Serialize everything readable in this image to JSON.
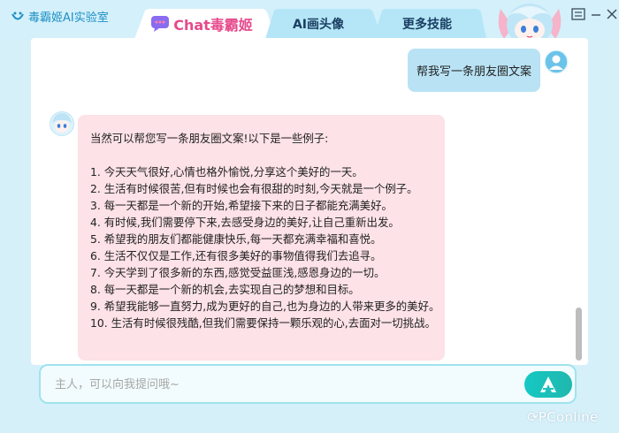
{
  "app": {
    "title": "毒霸姬AI实验室"
  },
  "tabs": [
    {
      "label": "Chat毒霸姬",
      "active": true,
      "icon": "chat-bubble-icon"
    },
    {
      "label": "AI画头像",
      "active": false
    },
    {
      "label": "更多技能",
      "active": false
    }
  ],
  "window_controls": [
    "menu-icon",
    "minimize-icon",
    "close-icon"
  ],
  "chat": {
    "user_message": "帮我写一条朋友圈文案",
    "bot_reply": {
      "intro": "当然可以帮您写一条朋友圈文案!以下是一些例子:",
      "lines": [
        "1. 今天天气很好,心情也格外愉悦,分享这个美好的一天。",
        "2. 生活有时候很苦,但有时候也会有很甜的时刻,今天就是一个例子。",
        "3. 每一天都是一个新的开始,希望接下来的日子都能充满美好。",
        "4. 有时候,我们需要停下来,去感受身边的美好,让自己重新出发。",
        "5. 希望我的朋友们都能健康快乐,每一天都充满幸福和喜悦。",
        "6. 生活不仅仅是工作,还有很多美好的事物值得我们去追寻。",
        "7. 今天学到了很多新的东西,感觉受益匪浅,感恩身边的一切。",
        "8. 每一天都是一个新的机会,去实现自己的梦想和目标。",
        "9. 希望我能够一直努力,成为更好的自己,也为身边的人带来更多的美好。",
        "10. 生活有时候很残酷,但我们需要保持一颗乐观的心,去面对一切挑战。"
      ]
    }
  },
  "input": {
    "placeholder": "主人，可以向我提问哦~",
    "value": ""
  },
  "watermark": "PConline",
  "colors": {
    "accent": "#1fc2bc",
    "bot_bubble": "#fde2e7",
    "user_bubble": "#b9e3f5",
    "background": "#d6f0fa"
  }
}
